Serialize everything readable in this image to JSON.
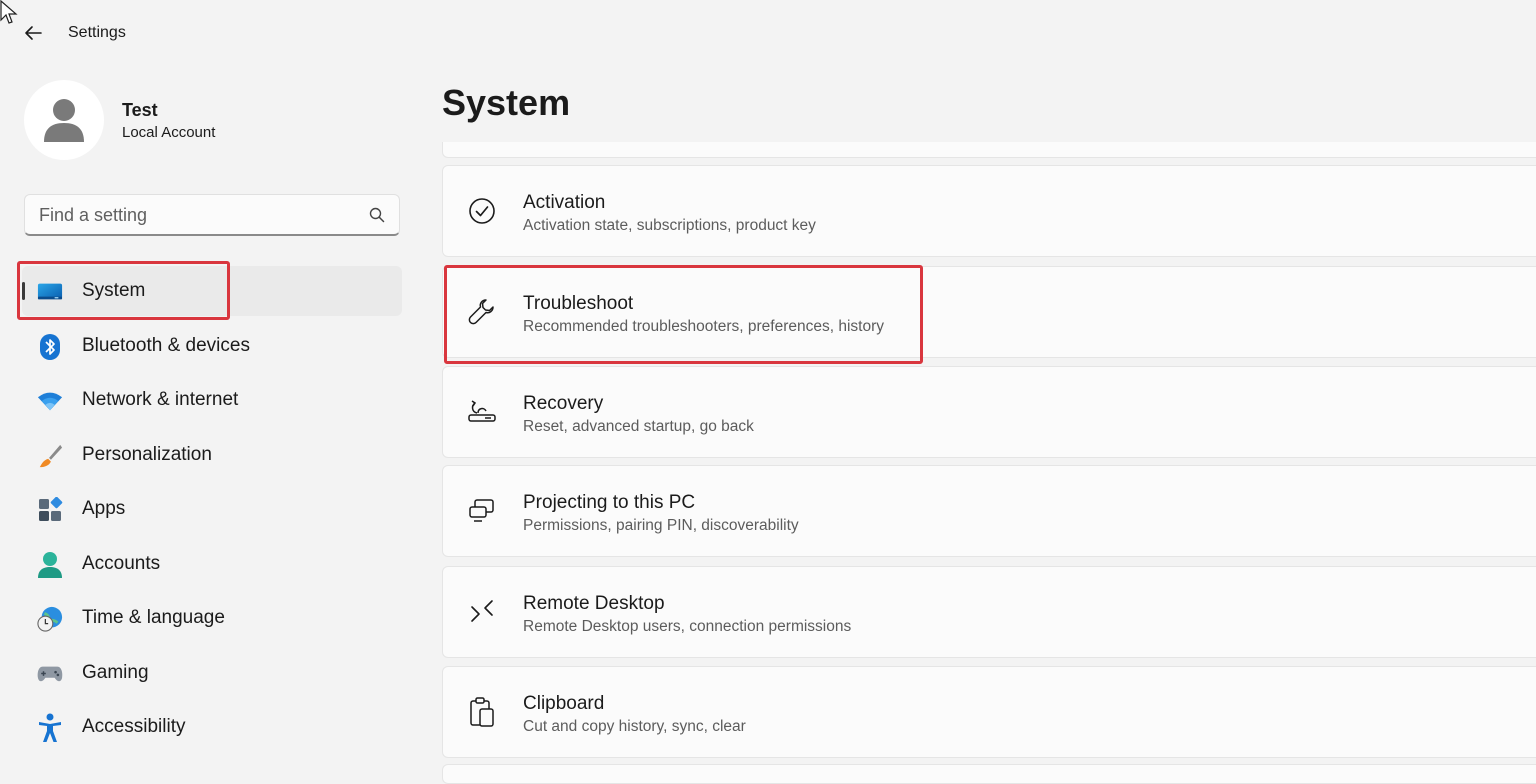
{
  "window": {
    "title": "Settings"
  },
  "profile": {
    "name": "Test",
    "account_type": "Local Account"
  },
  "search": {
    "placeholder": "Find a setting"
  },
  "sidebar": {
    "items": [
      {
        "label": "System",
        "icon": "system-icon",
        "selected": true
      },
      {
        "label": "Bluetooth & devices",
        "icon": "bluetooth-icon"
      },
      {
        "label": "Network & internet",
        "icon": "wifi-icon"
      },
      {
        "label": "Personalization",
        "icon": "paintbrush-icon"
      },
      {
        "label": "Apps",
        "icon": "apps-icon"
      },
      {
        "label": "Accounts",
        "icon": "accounts-icon"
      },
      {
        "label": "Time & language",
        "icon": "globe-clock-icon"
      },
      {
        "label": "Gaming",
        "icon": "gamepad-icon"
      },
      {
        "label": "Accessibility",
        "icon": "accessibility-icon"
      }
    ]
  },
  "main": {
    "title": "System",
    "cards": [
      {
        "title": "Activation",
        "subtitle": "Activation state, subscriptions, product key",
        "icon": "check-circle-icon"
      },
      {
        "title": "Troubleshoot",
        "subtitle": "Recommended troubleshooters, preferences, history",
        "icon": "wrench-icon",
        "highlighted": true
      },
      {
        "title": "Recovery",
        "subtitle": "Reset, advanced startup, go back",
        "icon": "recovery-icon"
      },
      {
        "title": "Projecting to this PC",
        "subtitle": "Permissions, pairing PIN, discoverability",
        "icon": "projecting-icon"
      },
      {
        "title": "Remote Desktop",
        "subtitle": "Remote Desktop users, connection permissions",
        "icon": "remote-desktop-icon"
      },
      {
        "title": "Clipboard",
        "subtitle": "Cut and copy history, sync, clear",
        "icon": "clipboard-icon"
      }
    ]
  },
  "colors": {
    "highlight": "#d9363e",
    "accent": "#0067c0",
    "background": "#f3f3f3",
    "card": "#fbfbfb"
  }
}
